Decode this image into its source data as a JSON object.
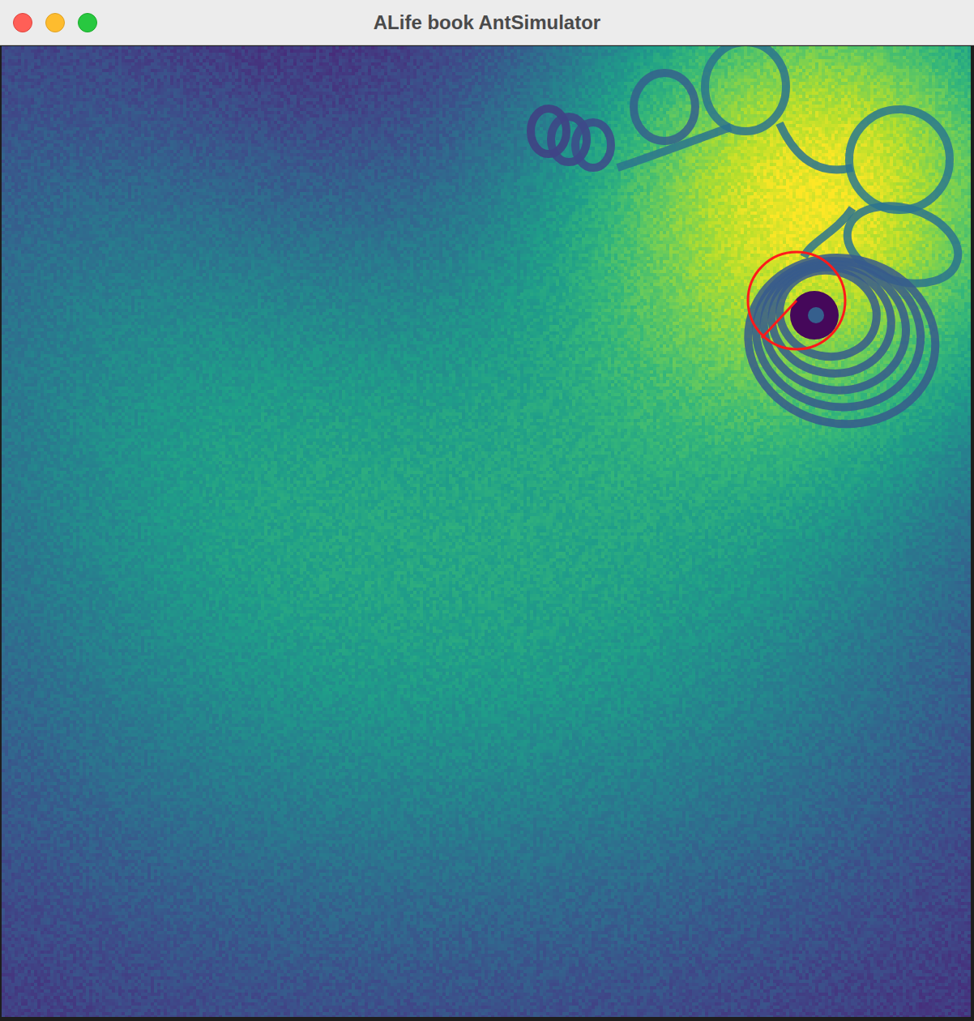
{
  "window": {
    "title": "ALife book AntSimulator"
  }
}
